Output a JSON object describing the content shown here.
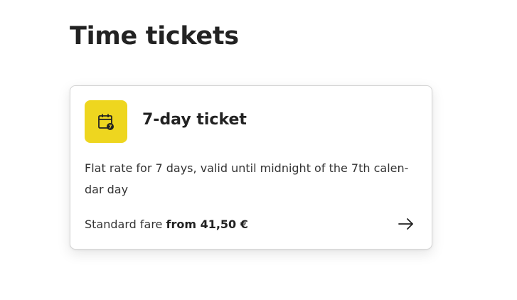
{
  "page": {
    "title": "Time tickets"
  },
  "card": {
    "icon": "calendar-7-icon",
    "title": "7-day ticket",
    "description": "Flat rate for 7 days, valid until midnight of the 7th calen-dar day",
    "price_prefix": "Standard fare",
    "price_value": "from 41,50 €",
    "arrow_icon": "arrow-right-icon",
    "icon_background": "#eed61f"
  }
}
